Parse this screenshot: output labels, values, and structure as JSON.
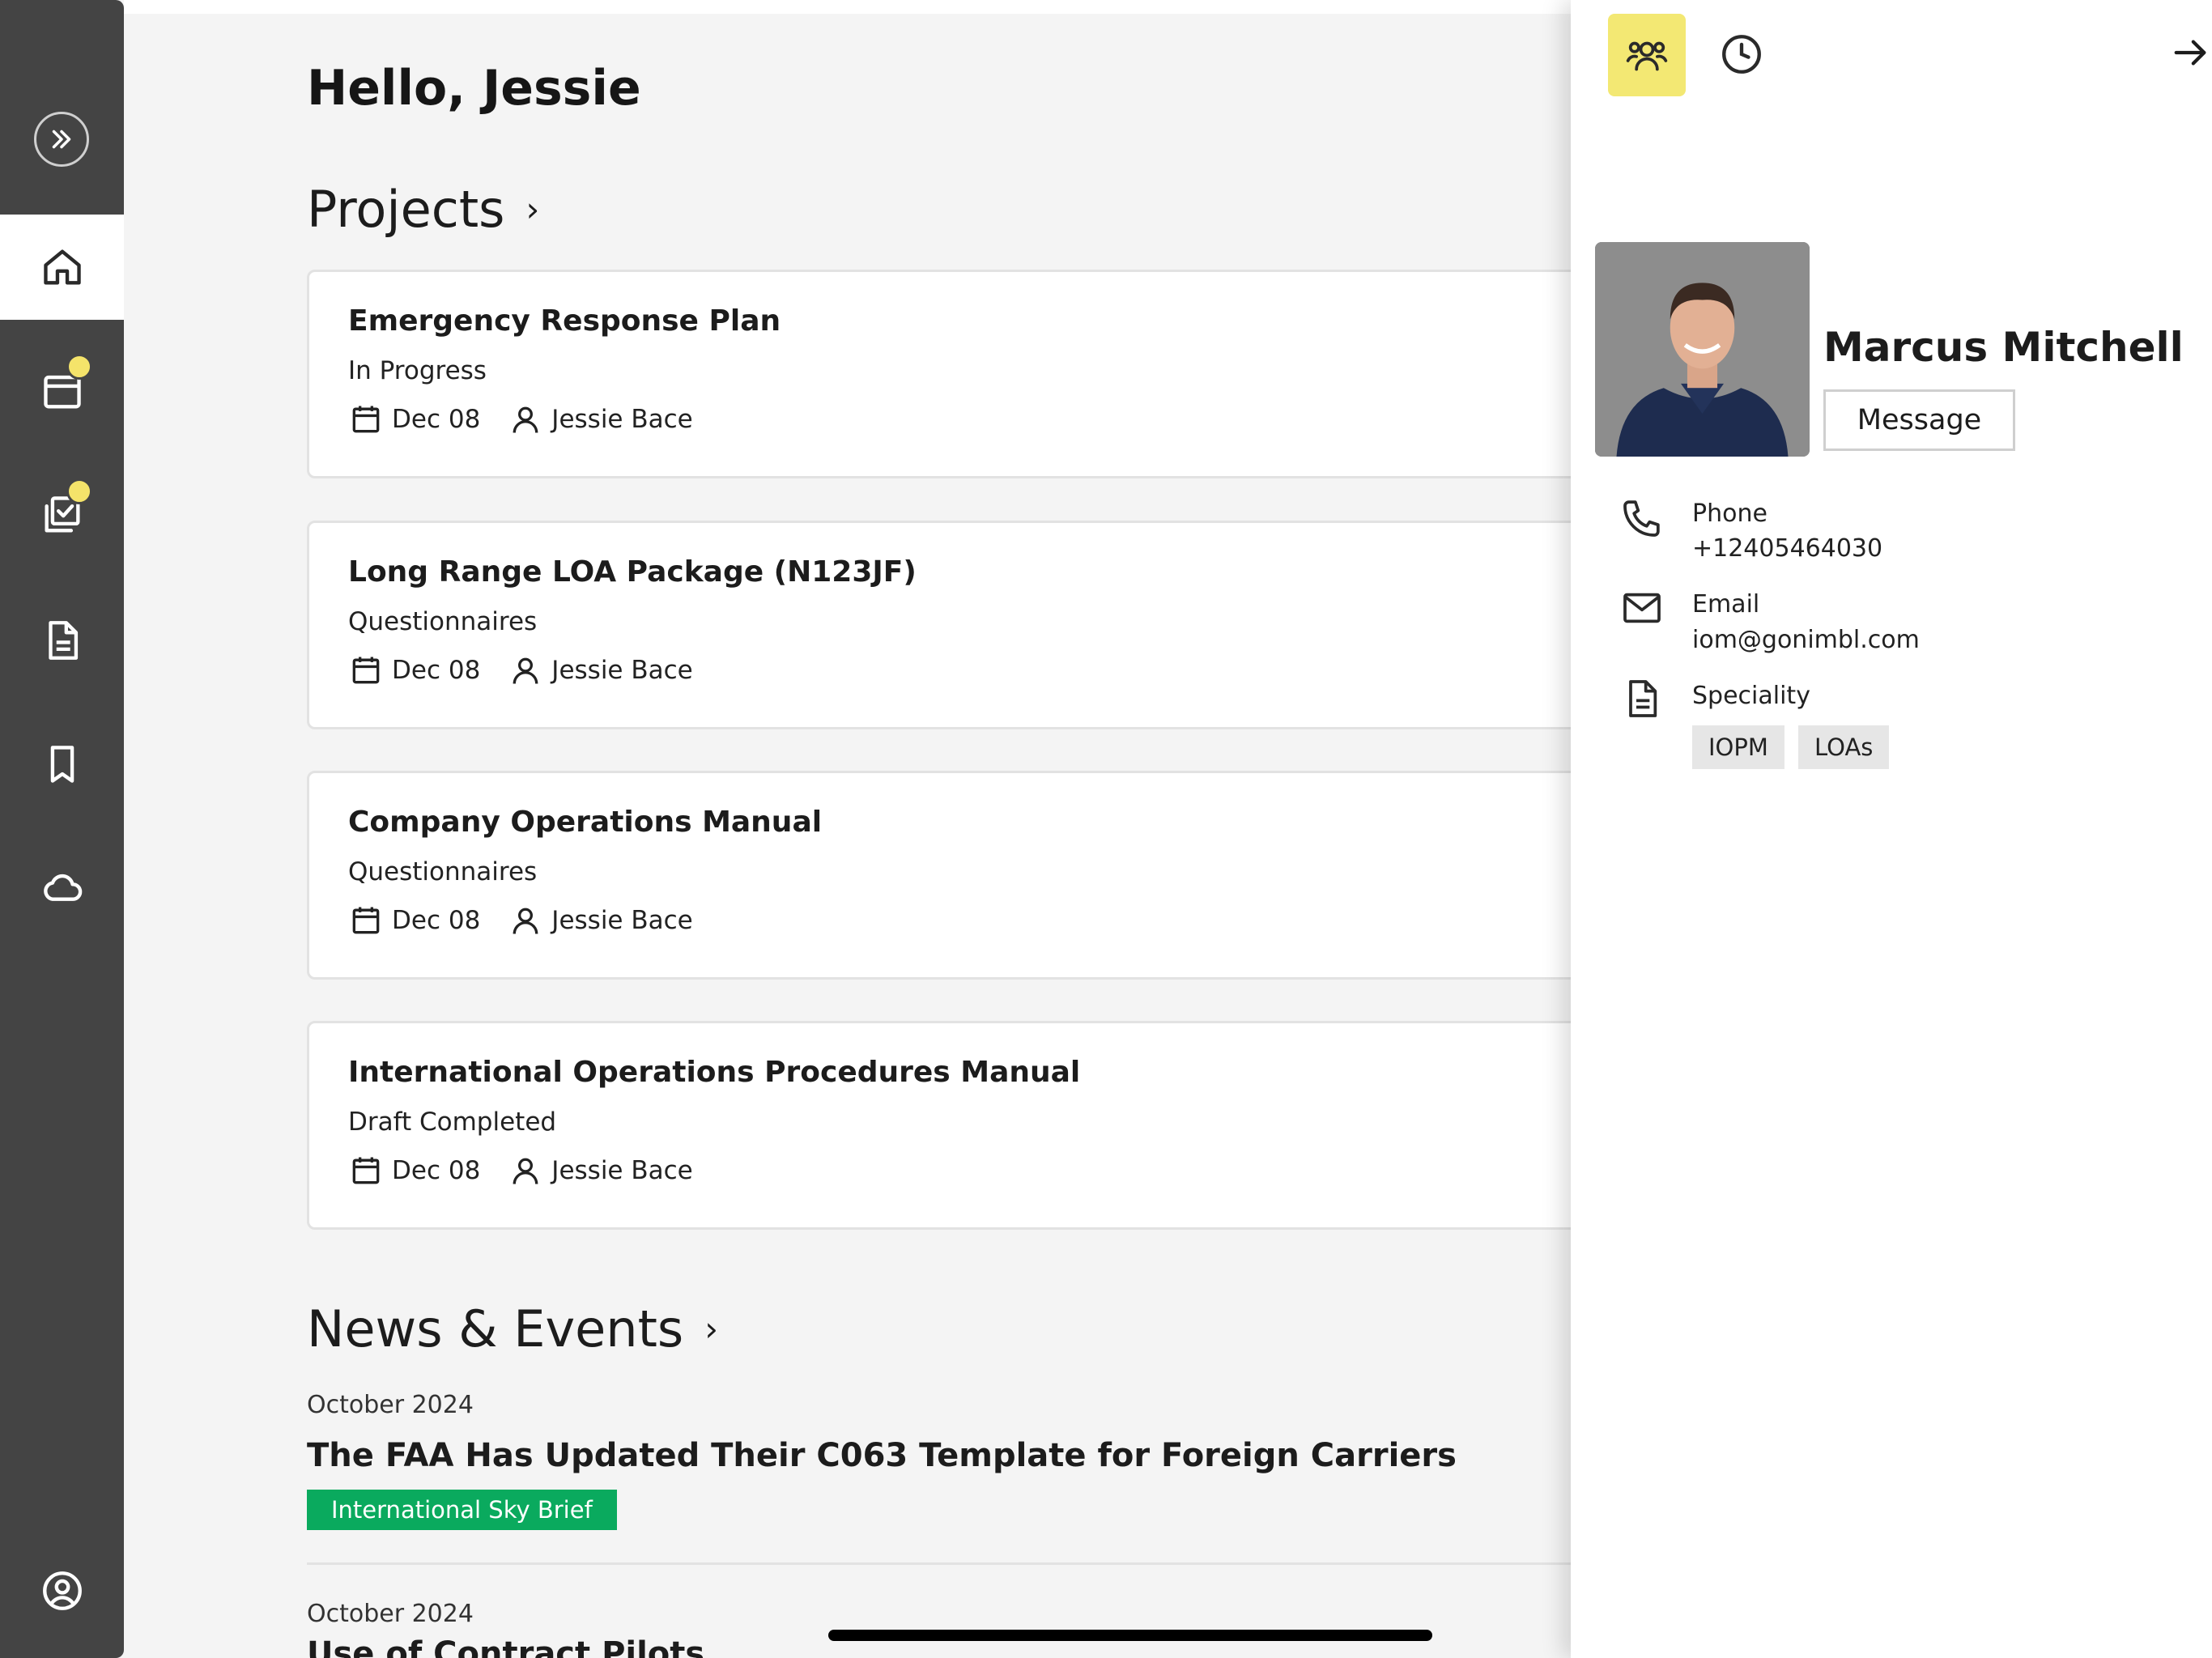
{
  "greeting": {
    "hello": "Hello,",
    "name": "Jessie"
  },
  "sections": {
    "projects": "Projects",
    "news": "News & Events"
  },
  "projects": [
    {
      "title": "Emergency Response Plan",
      "status": "In Progress",
      "date": "Dec 08",
      "owner": "Jessie Bace"
    },
    {
      "title": "Long Range LOA Package (N123JF)",
      "status": "Questionnaires",
      "date": "Dec 08",
      "owner": "Jessie Bace"
    },
    {
      "title": "Company Operations Manual",
      "status": "Questionnaires",
      "date": "Dec 08",
      "owner": "Jessie Bace"
    },
    {
      "title": "International Operations Procedures Manual",
      "status": "Draft Completed",
      "date": "Dec 08",
      "owner": "Jessie Bace"
    }
  ],
  "news": [
    {
      "date": "October 2024",
      "title": "The FAA Has Updated Their C063 Template for Foreign Carriers",
      "tag": "International Sky Brief"
    },
    {
      "date": "October 2024",
      "title": "Use of Contract Pilots"
    }
  ],
  "contact": {
    "name": "Marcus Mitchell",
    "message_label": "Message",
    "phone_label": "Phone",
    "phone": "+12405464030",
    "email_label": "Email",
    "email": "iom@gonimbl.com",
    "speciality_label": "Speciality",
    "specialities": [
      "IOPM",
      "LOAs"
    ]
  },
  "icons": {
    "sidebar": [
      "expand-icon",
      "home-icon",
      "calendar-icon",
      "tasks-icon",
      "document-icon",
      "bookmark-icon",
      "cloud-icon",
      "account-icon"
    ],
    "panel": [
      "contacts-icon",
      "clock-icon",
      "arrow-right-icon",
      "phone-icon",
      "mail-icon",
      "document-icon"
    ]
  },
  "colors": {
    "sidebar": "#444444",
    "accent": "#f3e873",
    "badge": "#f4e36a",
    "tag": "#0aaa5e"
  }
}
